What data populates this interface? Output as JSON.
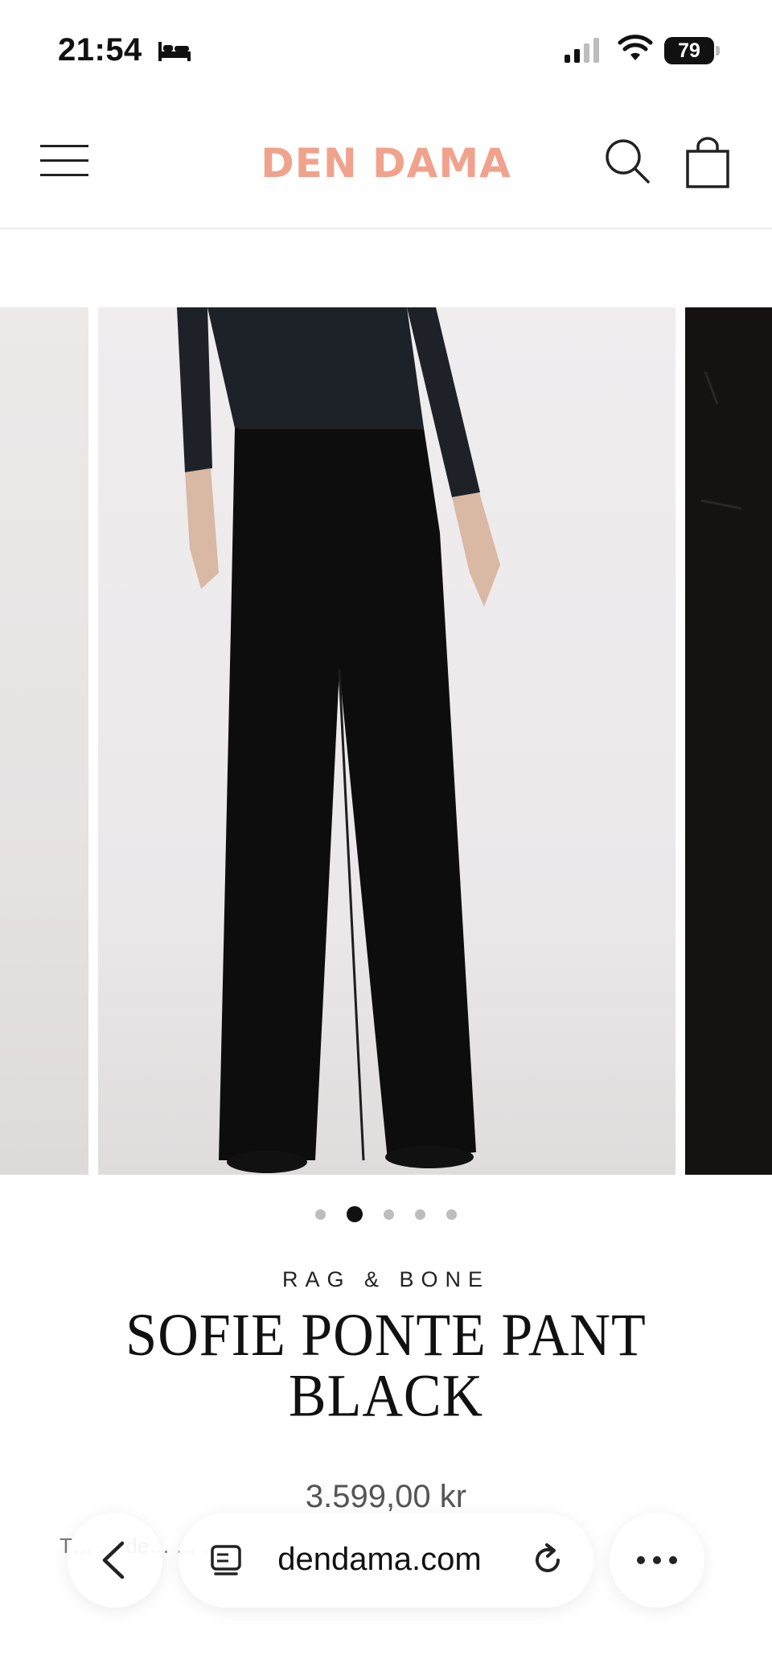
{
  "status_bar": {
    "time": "21:54",
    "battery": "79",
    "icons": [
      "bed-icon",
      "cellular-signal-icon",
      "wifi-icon",
      "battery-icon"
    ]
  },
  "header": {
    "logo": "DEN DAMA",
    "icons": [
      "hamburger-menu-icon",
      "search-icon",
      "shopping-bag-icon"
    ]
  },
  "gallery": {
    "slide_count": 5,
    "active_index": 1,
    "zoom_icon": "zoom-icon"
  },
  "product": {
    "brand": "RAG & BONE",
    "title": "SOFIE PONTE PANT BLACK",
    "price": "3.599,00 kr",
    "info_line": "T… … de… … …"
  },
  "browser": {
    "url": "dendama.com",
    "icons": [
      "back-arrow-icon",
      "tabs-icon",
      "reload-icon",
      "more-dots-icon"
    ]
  },
  "colors": {
    "logo": "#f0a28d",
    "text": "#111111",
    "price": "#555555"
  }
}
